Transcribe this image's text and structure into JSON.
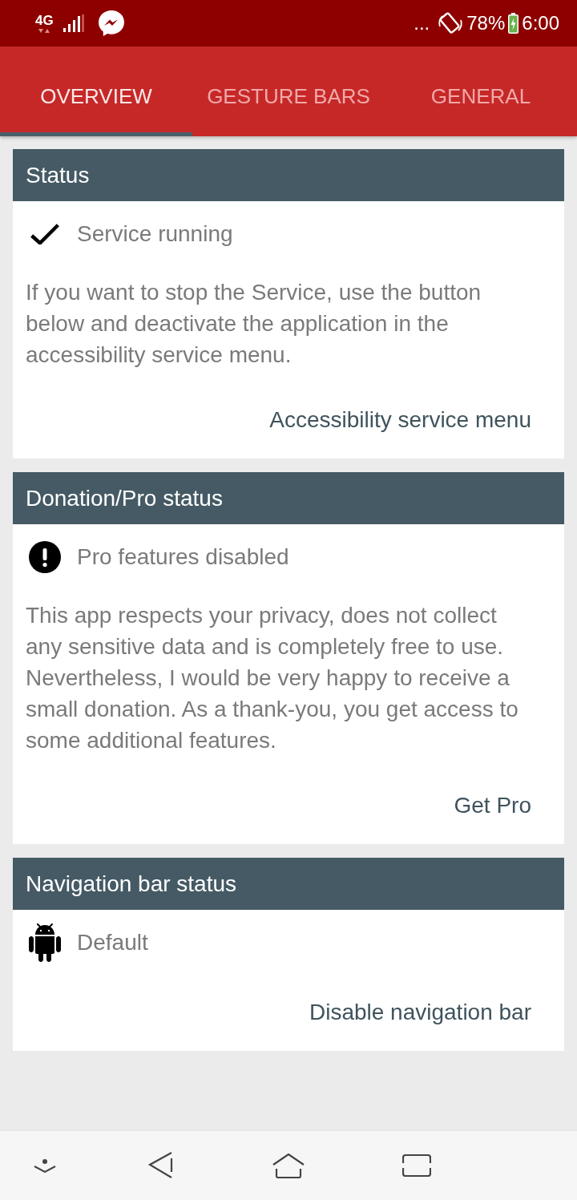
{
  "status_bar": {
    "network": "4G",
    "overflow": "...",
    "battery": "78%",
    "time": "6:00"
  },
  "tabs": [
    {
      "label": "OVERVIEW",
      "selected": true
    },
    {
      "label": "GESTURE BARS",
      "selected": false
    },
    {
      "label": "GENERAL",
      "selected": false
    }
  ],
  "cards": [
    {
      "title": "Status",
      "kind": "check",
      "status": "Service running",
      "description": "If you want to stop the Service, use the button below and deactivate the application in the accessibility service menu.",
      "action": "Accessibility service menu"
    },
    {
      "title": "Donation/Pro status",
      "kind": "alert",
      "status": "Pro features disabled",
      "description": "This app respects your privacy, does not collect any sensitive data and is completely free to use. Nevertheless, I would be very happy to receive a small donation. As a thank-you, you get access to some additional features.",
      "action": "Get Pro"
    },
    {
      "title": "Navigation bar status",
      "kind": "android",
      "status": "Default",
      "action": "Disable navigation bar"
    }
  ]
}
